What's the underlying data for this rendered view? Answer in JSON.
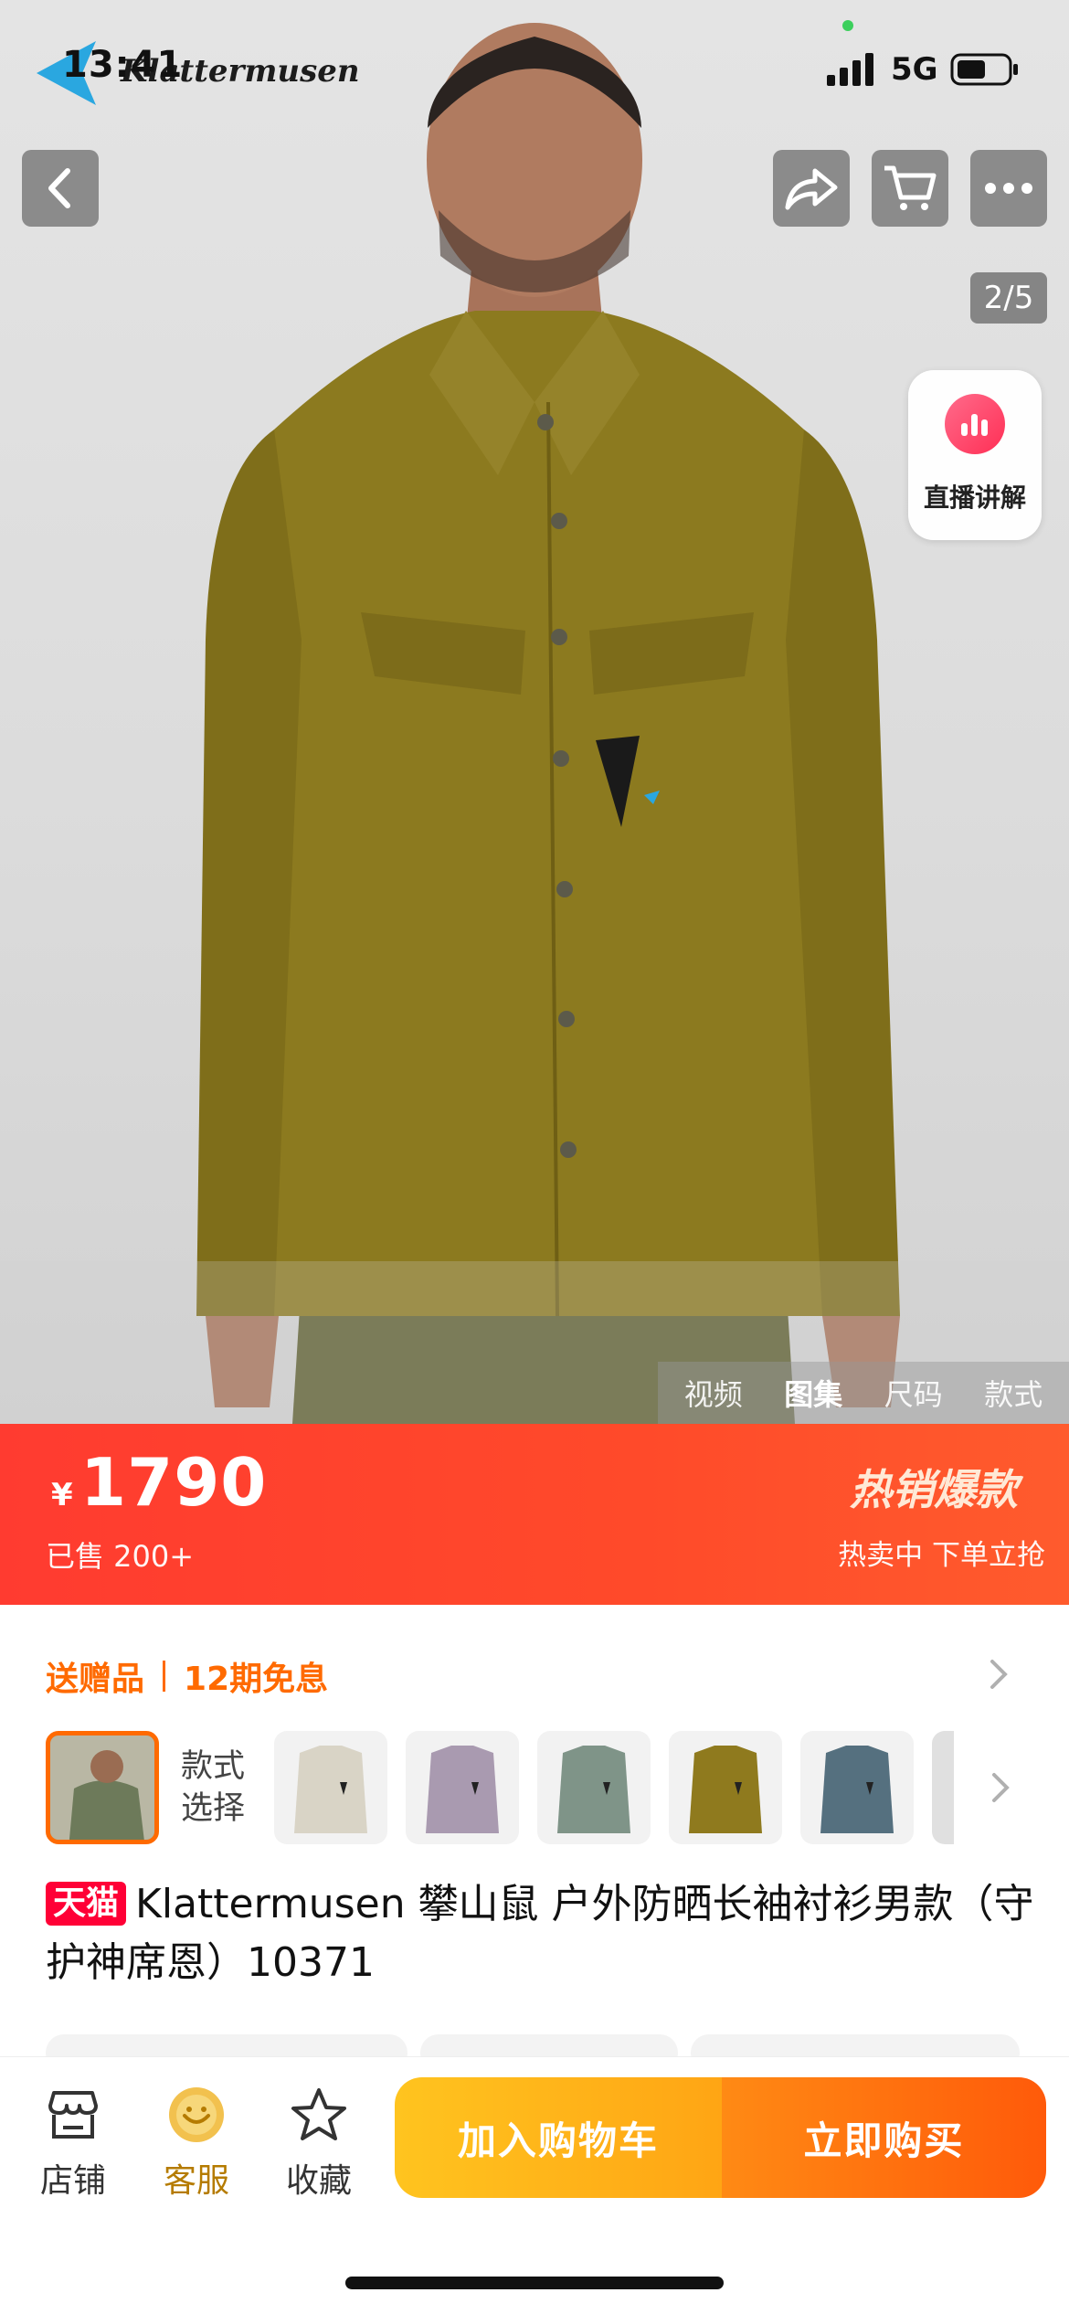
{
  "status_bar": {
    "time": "13:41",
    "network": "5G",
    "battery_icon": "battery-icon",
    "signal_icon": "signal-icon"
  },
  "brand": {
    "logo_text": "Klattermusen",
    "logo_color": "#2aa7e0"
  },
  "hero": {
    "image_counter": "2/5",
    "live_label": "直播讲解",
    "media_tabs": [
      {
        "label": "视频",
        "active": false
      },
      {
        "label": "图集",
        "active": true
      },
      {
        "label": "尺码",
        "active": false
      },
      {
        "label": "款式",
        "active": false
      }
    ]
  },
  "price_banner": {
    "currency": "¥",
    "price": "1790",
    "sold": "已售 200+",
    "hot_tag": "热销爆款",
    "hot_sub": "热卖中 下单立抢",
    "background": "#ff3b30"
  },
  "promo": {
    "gift": "送赠品",
    "installment": "12期免息",
    "accent": "#ff6a00"
  },
  "variants": {
    "label": "款式\n选择",
    "label_line1": "款式",
    "label_line2": "选择",
    "colors": [
      "#d9d4c6",
      "#a99ab0",
      "#7f9488",
      "#8f7a1e",
      "#55707f",
      "#e0e0e0"
    ]
  },
  "product": {
    "badge": "天猫",
    "title": "Klattermusen 攀山鼠 户外防晒长袖衬衫男款（守护神席恩）10371"
  },
  "bottom_bar": {
    "store": "店铺",
    "service": "客服",
    "favorite": "收藏",
    "add_to_cart": "加入购物车",
    "buy_now": "立即购买"
  }
}
